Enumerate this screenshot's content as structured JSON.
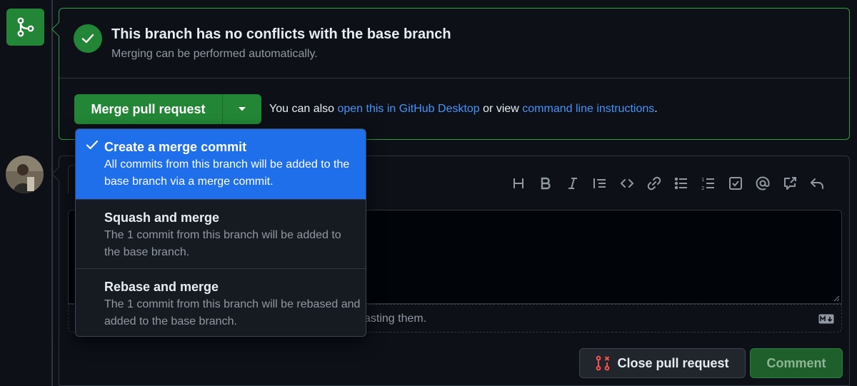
{
  "merge_status": {
    "title": "This branch has no conflicts with the base branch",
    "subtitle": "Merging can be performed automatically."
  },
  "merge_actions": {
    "merge_button_label": "Merge pull request",
    "also_prefix": "You can also ",
    "desktop_link": "open this in GitHub Desktop",
    "or_view": " or view ",
    "cli_link": "command line instructions",
    "suffix": "."
  },
  "merge_menu": {
    "items": [
      {
        "title": "Create a merge commit",
        "description": "All commits from this branch will be added to the base branch via a merge commit.",
        "selected": true
      },
      {
        "title": "Squash and merge",
        "description": "The 1 commit from this branch will be added to the base branch.",
        "selected": false
      },
      {
        "title": "Rebase and merge",
        "description": "The 1 commit from this branch will be rebased and added to the base branch.",
        "selected": false
      }
    ]
  },
  "comment_editor": {
    "toolbar_icons": [
      "heading-icon",
      "bold-icon",
      "italic-icon",
      "quote-icon",
      "code-icon",
      "link-icon",
      "unordered-list-icon",
      "ordered-list-icon",
      "task-list-icon",
      "mention-icon",
      "reference-icon",
      "reply-icon"
    ],
    "attach_hint_visible": "asting them.",
    "close_button_label": "Close pull request",
    "comment_button_label": "Comment"
  },
  "colors": {
    "success": "#238636",
    "link": "#4493f8",
    "selected": "#1f6feb",
    "danger": "#f85149",
    "background": "#0d1117"
  }
}
